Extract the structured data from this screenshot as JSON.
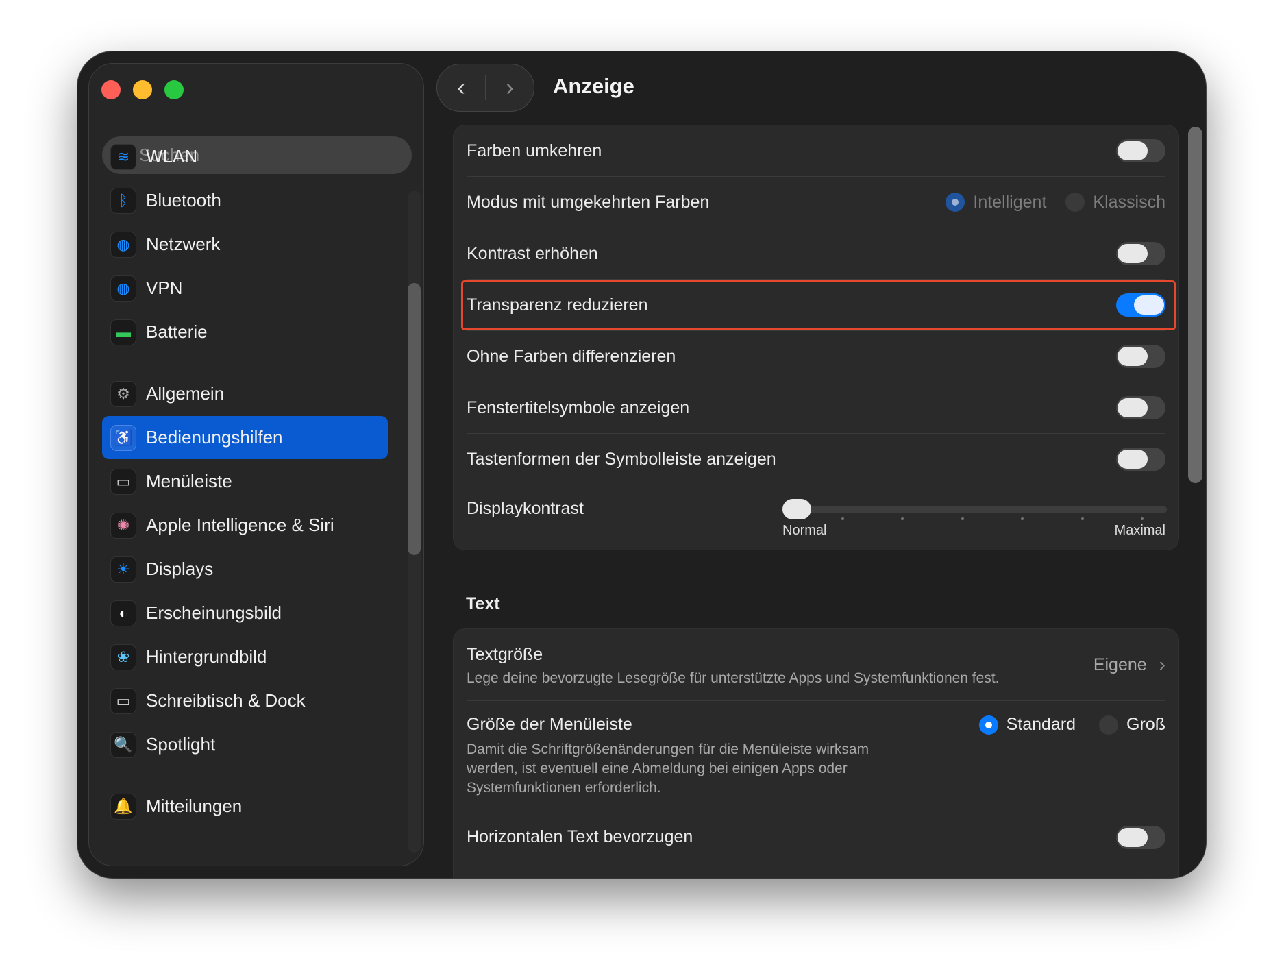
{
  "window": {
    "title": "Anzeige"
  },
  "sidebar": {
    "search_placeholder": "Suchen",
    "items": [
      {
        "label": "WLAN",
        "icon": "wifi-icon"
      },
      {
        "label": "Bluetooth",
        "icon": "bluetooth-icon"
      },
      {
        "label": "Netzwerk",
        "icon": "globe-icon"
      },
      {
        "label": "VPN",
        "icon": "vpn-icon"
      },
      {
        "label": "Batterie",
        "icon": "battery-icon"
      },
      {
        "label": "Allgemein",
        "icon": "gear-icon"
      },
      {
        "label": "Bedienungshilfen",
        "icon": "accessibility-icon",
        "selected": true
      },
      {
        "label": "Menüleiste",
        "icon": "menubar-icon"
      },
      {
        "label": "Apple Intelligence & Siri",
        "icon": "siri-icon"
      },
      {
        "label": "Displays",
        "icon": "sun-icon"
      },
      {
        "label": "Erscheinungsbild",
        "icon": "appearance-icon"
      },
      {
        "label": "Hintergrundbild",
        "icon": "wallpaper-icon"
      },
      {
        "label": "Schreibtisch & Dock",
        "icon": "dock-icon"
      },
      {
        "label": "Spotlight",
        "icon": "spotlight-icon"
      },
      {
        "label": "Mitteilungen",
        "icon": "bell-icon"
      }
    ]
  },
  "display": {
    "rows": [
      {
        "label": "Farben umkehren",
        "on": false
      },
      {
        "label": "Modus mit umgekehrten Farben",
        "options": [
          "Intelligent",
          "Klassisch"
        ],
        "selected": "Intelligent",
        "disabled": true
      },
      {
        "label": "Kontrast erhöhen",
        "on": false
      },
      {
        "label": "Transparenz reduzieren",
        "on": true,
        "highlighted": true
      },
      {
        "label": "Ohne Farben differenzieren",
        "on": false
      },
      {
        "label": "Fenstertitelsymbole anzeigen",
        "on": false
      },
      {
        "label": "Tastenformen der Symbolleiste anzeigen",
        "on": false
      }
    ],
    "contrast": {
      "label": "Displaykontrast",
      "min_label": "Normal",
      "max_label": "Maximal",
      "value": 0
    }
  },
  "text_section": {
    "header": "Text",
    "size": {
      "label": "Textgröße",
      "description": "Lege deine bevorzugte Lesegröße für unterstützte Apps und Systemfunktionen fest.",
      "value": "Eigene"
    },
    "menubar_size": {
      "label": "Größe der Menüleiste",
      "description": "Damit die Schriftgrößenänderungen für die Menüleiste wirksam werden, ist eventuell eine Abmeldung bei einigen Apps oder Systemfunktionen erforderlich.",
      "options": [
        "Standard",
        "Groß"
      ],
      "selected": "Standard"
    },
    "horizontal": {
      "label": "Horizontalen Text bevorzugen",
      "on": false
    }
  },
  "colors": {
    "accent": "#0a7bff",
    "selection": "#0a5bd1",
    "highlight": "#e5482c"
  }
}
